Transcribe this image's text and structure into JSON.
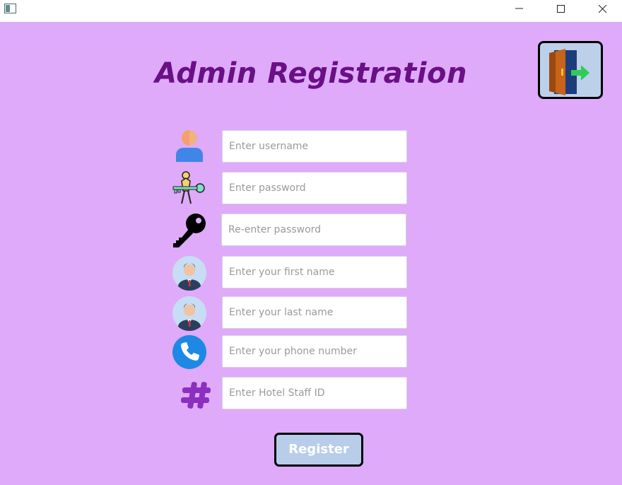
{
  "window": {
    "minimize_icon": "minimize-icon",
    "maximize_icon": "maximize-icon",
    "close_icon": "close-icon"
  },
  "page": {
    "title": "Admin Registration",
    "background_color": "#dfaaf9",
    "title_color": "#6a0f86"
  },
  "exit_button": {
    "icon": "exit-door-icon"
  },
  "fields": {
    "username": {
      "placeholder": "Enter username",
      "icon": "user-icon"
    },
    "password": {
      "placeholder": "Enter password",
      "icon": "key-person-icon"
    },
    "reenter_password": {
      "placeholder": "Re-enter password",
      "icon": "key-icon"
    },
    "first_name": {
      "placeholder": "Enter your first name",
      "icon": "businessman-avatar-icon"
    },
    "last_name": {
      "placeholder": "Enter your last name",
      "icon": "businessman-avatar-icon"
    },
    "phone": {
      "placeholder": "Enter your phone number",
      "icon": "phone-icon"
    },
    "staff_id": {
      "placeholder": "Enter Hotel Staff ID",
      "icon": "hash-icon"
    }
  },
  "register_button": {
    "label": "Register",
    "background_color": "#b7cdea"
  }
}
